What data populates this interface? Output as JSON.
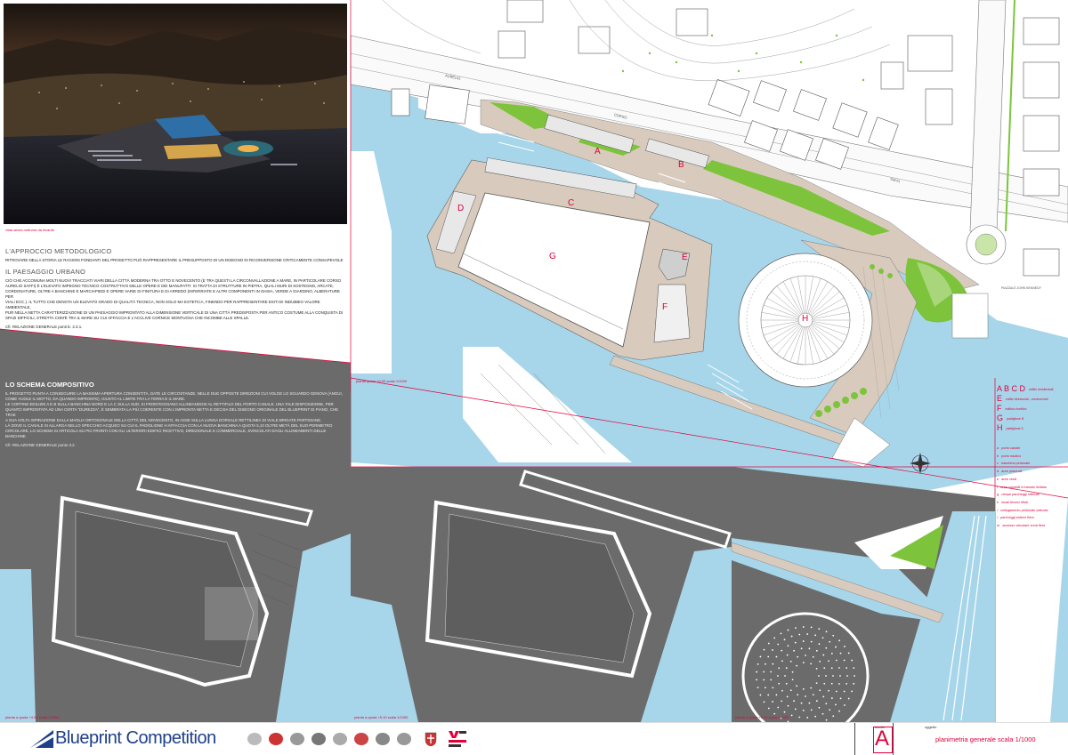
{
  "photo_caption": "vista aerea notturna da levante",
  "approach": {
    "title": "L'APPROCCIO METODOLOGICO",
    "text": "RITROVARE NELLA STORIA LE RAGIONI FONDANTI DEL PROGETTO PUÒ RAPPRESENTARE IL PRESUPPOSTO DI UN DISEGNO DI RICONVERSIONE CRITICAMENTE CONSAPEVOLE"
  },
  "landscape": {
    "title": "IL PAESAGGIO URBANO",
    "lines": [
      "CIÒ CHE ACCOMUNA MOLTI NUOVI TRACCIATI VIARI DELLA CITTÀ MODERNA TRA OTTO E NOVECENTO (E TRA QUESTI LA CIRCONVALLAZIONE A MARE, IN PARTICOLARE CORSO",
      "AURELIO SAFFI) È L'ELEVATO IMPEGNO TECNICO COSTRUTTIVO DELLE OPERE E DEI MANUFATTI: SI TRATTA DI STRUTTURE IN PIETRA, QUALI MURI DI SOSTEGNO, ARCATE,",
      "CORDONATURE, OLTRE A BANCHINE E MARCIAPIEDI E OPERE VARIE DI FINITURA E DI ARREDO (INFERRIATE E ALTRI COMPONENTI IN GHISA, VERDE A GIARDINO, ALBERATURE PER",
      "VIALI ECC.). IL TUTTO CHE DENOTA UN ELEVATO GRADO DI QUALITÀ TECNICA, NON SOLO MA ESTETICA, FINENDO PER RAPPRESENTARE ESITI DI INDUBBIO VALORE AMBIENTALE,",
      "PUR NELLA NETTA CARATTERIZZAZIONE DI UN PAESAGGIO IMPRONTATO ALLA DIMENSIONE VERTICALE DI UNA CITTÀ PREDISPOSTA PER ANTICO COSTUME ALLA CONQUISTA DI",
      "SPAZI DIFFICILI, STRETTA COM'È TRA IL MARE SU CUI AFFACCIA E L'ACCLIVE CORNICE MONTUOSA CHE INCOMBE ALLE SPALLE."
    ],
    "ref": "Cfr. RELAZIONE GENERALE punti E. 2.3.1."
  },
  "scheme": {
    "title": "LO SCHEMA COMPOSITIVO",
    "lines": [
      "IL PROGETTO PUNTA A CONSEGUIRE LA MASSIMA APERTURA CONSENTITA, DATE LE CIRCOSTANZE, NELLE DUE OPPOSTE DIREZIONI CUI VOLGE LO SGUARDO GENOVA (ANGUI,",
      "COME VUOLE IL MOTTO, DA QUANDO IMPRONTE), GIUSTO AL LIMITE TRA LA TERRA E IL MARE.",
      "LE CORTINE EDILIZIE A E B SULLA BANCHINA NORD E LA C SULLA SUD, SI FRONTEGGIANO ALLINEANDOSI AL RETTIFILO DEL PORTO CANALE. UNA TALE DISPOSIZIONE, PER",
      "QUANTO IMPRONTATA AD UNA CERTA \"DUREZZA\", È SEMBRATA LA PIÙ COERENTE CON L'IMPRONTA NETTA E DECISA DEL DISEGNO ORIGINALE DEL BLUEPRINT DI PIANO, CHE TRAE",
      "A SUA VOLTA ISPIRAZIONE DALLA MAGLIA ORTOGONALE DELLA CITTÀ DEL NOVECENTO, IN ASSE SULLA LUNGA DORSALE RETTILINEA DI VIALE BRIGATE PARTIGIANE.",
      "LÀ DOVE IL CANALE SI ALLARGA NELLO SPECCHIO ACQUEO SU CUI IL PADIGLIONE H AFFACCIA CON LA NUOVA BANCHINA A QUOTA 5,10 OLTRE METÀ DEL SUO PERIMETRO",
      "CIRCOLARE, LO SCHEMA SI ARTICOLA SU PIÙ FRONTI CON GLI ULTERIORI EDIFICI RICETTIVO, DIREZIONALE E COMMERCIALE, SVINCOLATI DAGLI ALLINEAMENTI DELLE BANCHINE."
    ],
    "ref": "Cfr. RELAZIONE GENERALE punto 3.2."
  },
  "map_labels": {
    "street_aurelio": "AURELIO",
    "street_corso": "CORSO",
    "street_saffi": "SAFFI",
    "piazzale": "PIAZZALE JOHN KENNEDY",
    "plan_caption": "pianta quota +0.00   scala 1/1000"
  },
  "buildings": [
    "A",
    "B",
    "C",
    "D",
    "E",
    "F",
    "G",
    "H"
  ],
  "legend_big": [
    {
      "letters": "A B C D",
      "desc": "edifici residenziali"
    },
    {
      "letters": "E",
      "desc": "edifici direzionali - commerciali"
    },
    {
      "letters": "F",
      "desc": "edificio ricettivo"
    },
    {
      "letters": "G",
      "desc": "padiglione B"
    },
    {
      "letters": "H",
      "desc": "padiglione S"
    }
  ],
  "legend_small": [
    {
      "key": "a",
      "desc": "porto canale"
    },
    {
      "key": "b",
      "desc": "porto nautico"
    },
    {
      "key": "c",
      "desc": "banchina pedonale"
    },
    {
      "key": "d",
      "desc": "aree pedonali"
    },
    {
      "key": "e",
      "desc": "aree verdi"
    },
    {
      "key": "f",
      "desc": "aree carrabili a transito limitato"
    },
    {
      "key": "g",
      "desc": "rampe parcheggi interrati"
    },
    {
      "key": "h",
      "desc": "locali tecnici rifiuti"
    },
    {
      "key": "i",
      "desc": "collegamento pedonale sottovia"
    },
    {
      "key": "l",
      "desc": "parcheggi esterni fiera"
    },
    {
      "key": "m",
      "desc": "accesso veicolare zona fiera"
    }
  ],
  "bottom_captions": [
    "pianta a quota +4.90   scala 1/1000",
    "pianta a quota +5.10   scala 1/1000",
    "pianta a quota +5.10   scala 1/1000"
  ],
  "footer": {
    "brand_a": "Blueprint ",
    "brand_b": "Competition",
    "tab_label": "tavola",
    "tab_letter": "A",
    "obj_label": "oggetto",
    "title": "planimetria generale  scala 1/1000"
  },
  "colors": {
    "water": "#a7d6ea",
    "land": "#6b6b6b",
    "green": "#7dc43c",
    "accent": "#e0003a"
  }
}
